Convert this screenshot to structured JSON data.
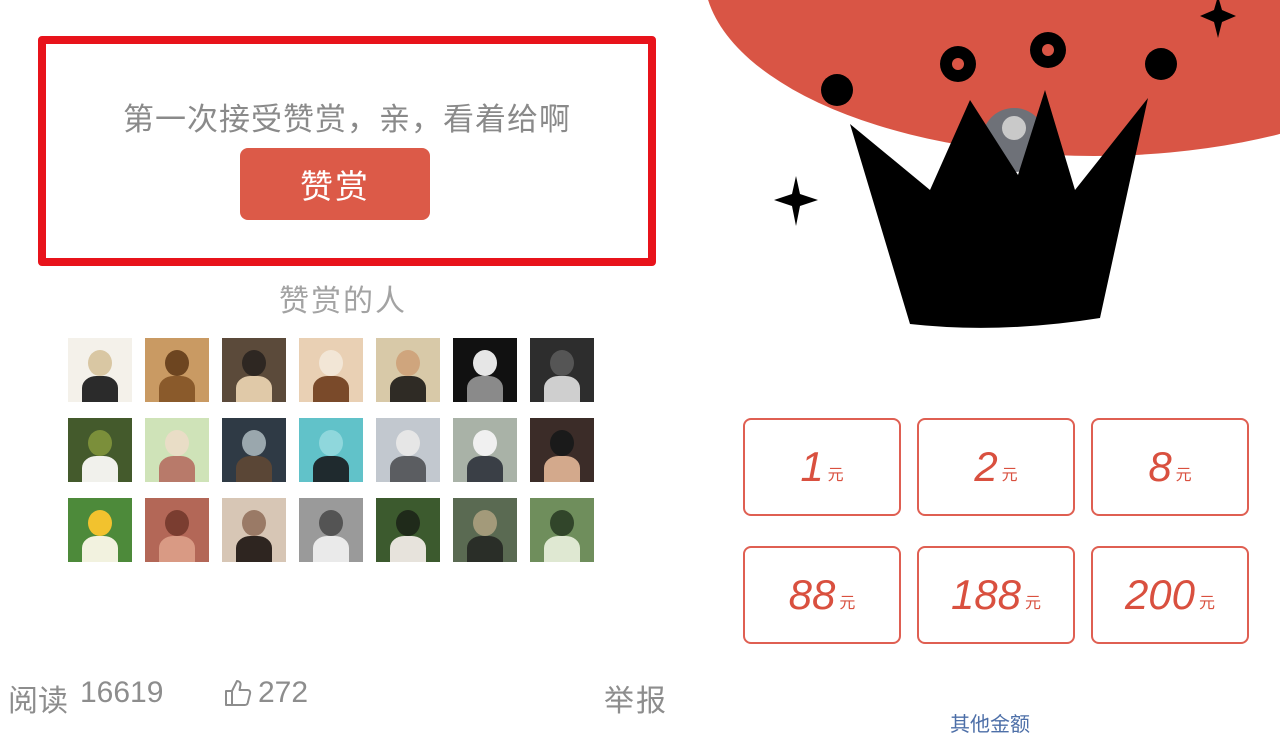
{
  "reward": {
    "prompt": "第一次接受赞赏，亲，看着给啊",
    "button_label": "赞赏",
    "highlight_color": "#e8131b",
    "button_color": "#dc5a48"
  },
  "donors": {
    "title": "赞赏的人",
    "count": 21
  },
  "footer": {
    "read_label": "阅读",
    "read_count": "16619",
    "like_icon": "thumbs-up-icon",
    "like_count": "272",
    "report_label": "举报"
  },
  "amounts": [
    {
      "value": "1",
      "unit": "元"
    },
    {
      "value": "2",
      "unit": "元"
    },
    {
      "value": "8",
      "unit": "元"
    },
    {
      "value": "88",
      "unit": "元"
    },
    {
      "value": "188",
      "unit": "元"
    },
    {
      "value": "200",
      "unit": "元"
    }
  ],
  "other_amount_label": "其他金额",
  "theme": {
    "accent": "#d95545",
    "link": "#4d6fa8"
  }
}
